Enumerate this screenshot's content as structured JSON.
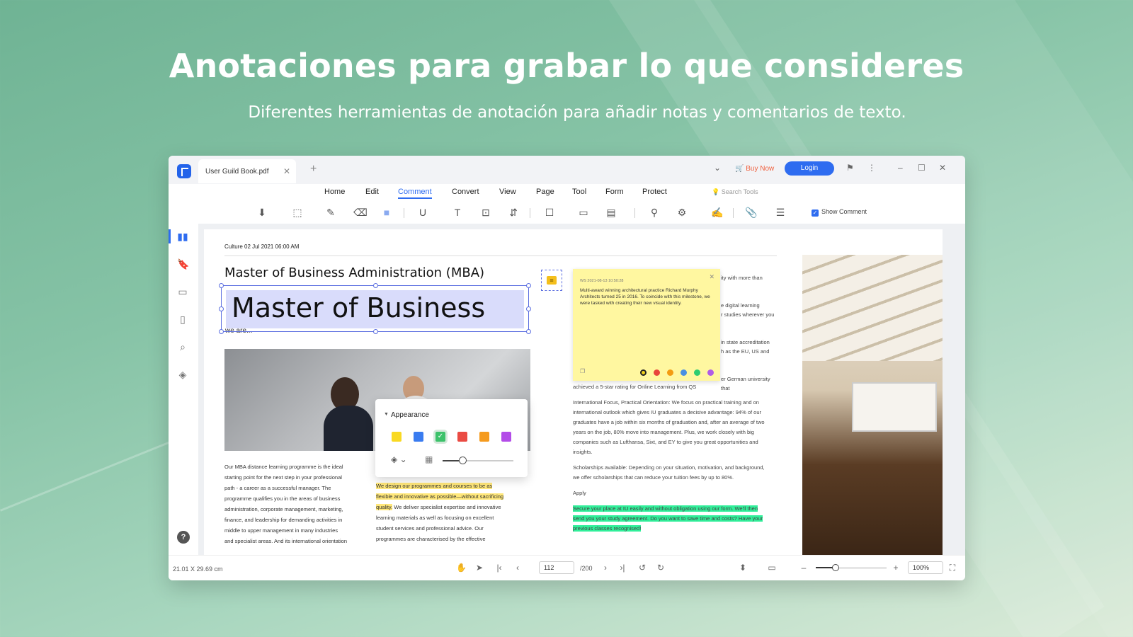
{
  "hero": {
    "title": "Anotaciones para grabar lo que consideres",
    "subtitle": "Diferentes herramientas de anotación para añadir notas y comentarios de texto."
  },
  "titlebar": {
    "tab_label": "User Guild Book.pdf",
    "buy_now": "Buy Now",
    "login": "Login"
  },
  "menu": {
    "items": [
      "Home",
      "Edit",
      "Comment",
      "Convert",
      "View",
      "Page",
      "Tool",
      "Form",
      "Protect"
    ],
    "active": "Comment",
    "search_placeholder": "Search Tools"
  },
  "toolbar": {
    "show_comment": "Show Comment",
    "show_comment_checked": true
  },
  "document": {
    "date": "Culture 02 Jul 2021 06:00 AM",
    "heading": "Master of Business Administration (MBA)",
    "selected_text": "Master of Business",
    "cut_text": "we are...",
    "left_col": [
      "Our MBA distance learning programme is the ideal",
      "starting point for the next step in your professional",
      "path - a career as a successful manager. The",
      "programme qualifies you in the areas of business",
      "administration, corporate management, marketing,",
      "finance, and leadership for demanding activities in",
      "middle to upper management in many industries",
      "and specialist areas. And its international orientation"
    ],
    "mid_col_highlighted": [
      "We design our programmes and courses to be as",
      "flexible and innovative as possible—without sacrificing",
      "quality."
    ],
    "mid_col_rest": " We deliver specialist expertise and innovative",
    "mid_col_more": [
      "learning materials as well as focusing on excellent",
      "student services and professional advice. Our",
      "programmes are characterised by the effective"
    ],
    "right_col_top": [
      "ity with more than",
      "",
      "",
      "e digital learning",
      "r studies wherever you",
      "",
      "",
      "in state accreditation",
      "h as the EU, US and",
      "",
      "",
      "er German university that"
    ],
    "right_col_1": "achieved a 5-star rating for Online Learning from QS",
    "right_col_2": [
      "International Focus, Practical Orientation: We focus on practical training and on",
      "international outlook which gives IU graduates a decisive advantage: 94% of our",
      "graduates have a job within six months of graduation and, after an average of two",
      "years on the job, 80% move into management. Plus, we work closely with big",
      "companies such as Lufthansa, Sixt, and EY to give you great opportunities and",
      "insights."
    ],
    "right_col_3": [
      "Scholarships available: Depending on your situation, motivation, and background,",
      "we offer scholarships that can reduce your tuition fees by up to 80%."
    ],
    "right_col_apply": "Apply",
    "right_col_green": [
      "Secure your place at IU easily and without obligation using our form. We'll then",
      "send you your study agreement. Do you want to save time and costs? Have your",
      "previous classes recognised!"
    ]
  },
  "sticky_note": {
    "meta": "WS 2021-08-13 10:50:28",
    "body": "Multi-award winning architectural practice Richard Murphy Architects turned 25 in 2016. To coincide with this milestone, we were tasked with creating their new visual identity.",
    "colors": [
      "#f2d21b",
      "#e8453c",
      "#f39c12",
      "#4a90e2",
      "#2ecc71",
      "#b05ce6"
    ]
  },
  "appearance_popup": {
    "title": "Appearance",
    "swatches": [
      "#f9d923",
      "#3a7cf0",
      "#3cc26a",
      "#ea4b43",
      "#f59b1e",
      "#b34ce8"
    ],
    "selected_swatch": 2,
    "opacity": 0.27
  },
  "statusbar": {
    "dimensions": "21.01 X 29.69 cm",
    "page": "112",
    "total": "/200",
    "zoom": "100%",
    "zoom_level": 0.27
  }
}
